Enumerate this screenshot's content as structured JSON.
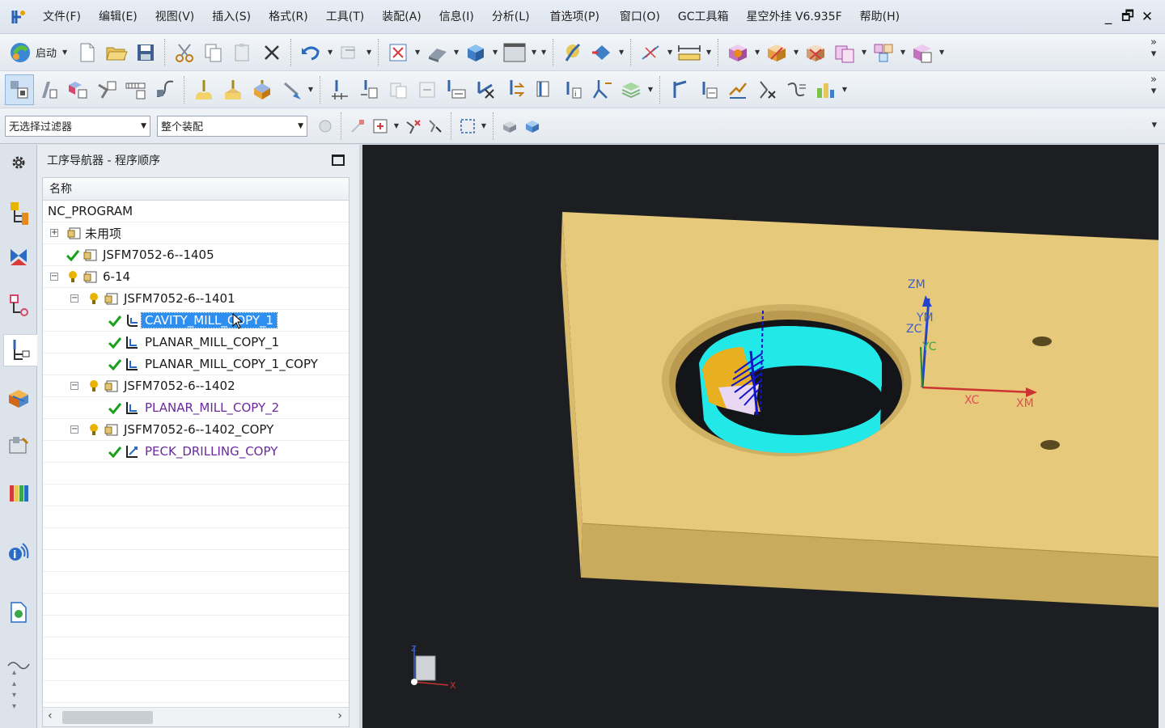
{
  "menubar": {
    "items": [
      "文件(F)",
      "编辑(E)",
      "视图(V)",
      "插入(S)",
      "格式(R)",
      "工具(T)",
      "装配(A)",
      "信息(I)",
      "分析(L)",
      "首选项(P)",
      "窗口(O)",
      "GC工具箱",
      "星空外挂 V6.935F",
      "帮助(H)"
    ],
    "window_controls": [
      "_",
      "🗗",
      "✕"
    ]
  },
  "toolbar1": {
    "start_label": "启动",
    "overflow": "»"
  },
  "toolbar2": {
    "overflow": "»"
  },
  "toolbar3": {
    "filter_value": "无选择过滤器",
    "assembly_value": "整个装配"
  },
  "navigator": {
    "title": "工序导航器 - 程序顺序",
    "column_name": "名称",
    "rows": [
      {
        "label": "NC_PROGRAM"
      },
      {
        "label": "未用项"
      },
      {
        "label": "JSFM7052-6--1405"
      },
      {
        "label": "6-14"
      },
      {
        "label": "JSFM7052-6--1401"
      },
      {
        "label": "CAVITY_MILL_COPY_1"
      },
      {
        "label": "PLANAR_MILL_COPY_1"
      },
      {
        "label": "PLANAR_MILL_COPY_1_COPY"
      },
      {
        "label": "JSFM7052-6--1402"
      },
      {
        "label": "PLANAR_MILL_COPY_2"
      },
      {
        "label": "JSFM7052-6--1402_COPY"
      },
      {
        "label": "PECK_DRILLING_COPY"
      }
    ]
  },
  "viewport": {
    "axes": {
      "zm": "ZM",
      "ym": "YM",
      "zc": "ZC",
      "yc": "YC",
      "xc": "XC",
      "xm": "XM"
    },
    "triad": {
      "z": "Z",
      "x": "X"
    },
    "colors": {
      "background": "#1c1e22",
      "part_top": "#e7c97b",
      "part_front": "#c8ab5c",
      "cavity": "#22e8e8",
      "toolpath": "#1414c8"
    }
  },
  "colors": {
    "selection": "#2e8ff0",
    "operation_text": "#6a2a9e",
    "check": "#1aa01a",
    "bulb": "#e8b400"
  }
}
